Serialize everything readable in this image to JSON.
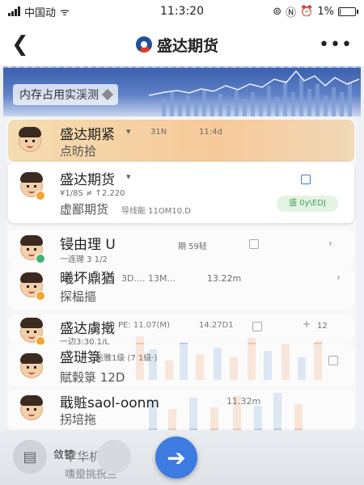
{
  "status_bar": {
    "carrier": "中国动",
    "time": "11:3:20",
    "battery": "1%",
    "battery_level": 0.01
  },
  "nav": {
    "back_glyph": "❮",
    "title": "盛达期货",
    "more_glyph": "•••"
  },
  "banner": {
    "label": "内存占用实渓测"
  },
  "rows": [
    {
      "name": "盛达期紧",
      "caret": "▾",
      "sub": "点昉拾",
      "meta1": "31N",
      "meta2": "11:4d"
    },
    {
      "name": "盛达期货",
      "caret": "▾",
      "sub": "虚鄙期货",
      "meta": "¥1/8S ≠ ↑2.220",
      "mono": "导线能  11OM10.D",
      "tag": "盛  0y\\EDJ"
    },
    {
      "name": "锓由理 U",
      "meta": "一连理 3 1/2",
      "m2": "期   59轻"
    },
    {
      "name": "曦坏鼑猶",
      "sub": "探榀摳",
      "mono": "3D.... 13M...  ",
      "m2": "13.22m"
    },
    {
      "name": "盛达虜撠",
      "mono": "PE: 11.07(M)",
      "m2": "14.27D1",
      "meta": "一边3:30.1/L",
      "m3": "12"
    },
    {
      "name": "盛琎箓",
      "sub": "賦榖箓 12D",
      "meta": "能雅1级 (7 1级·)"
    },
    {
      "name": "戢賘saol-oonm",
      "sub": "拐培拖",
      "m2": "11.32m"
    }
  ],
  "bottom": {
    "label1": "敛锖",
    "label2": "䍐华机撅",
    "label3": "嚑跫挑拀兰",
    "fab_glyph": "➔"
  }
}
